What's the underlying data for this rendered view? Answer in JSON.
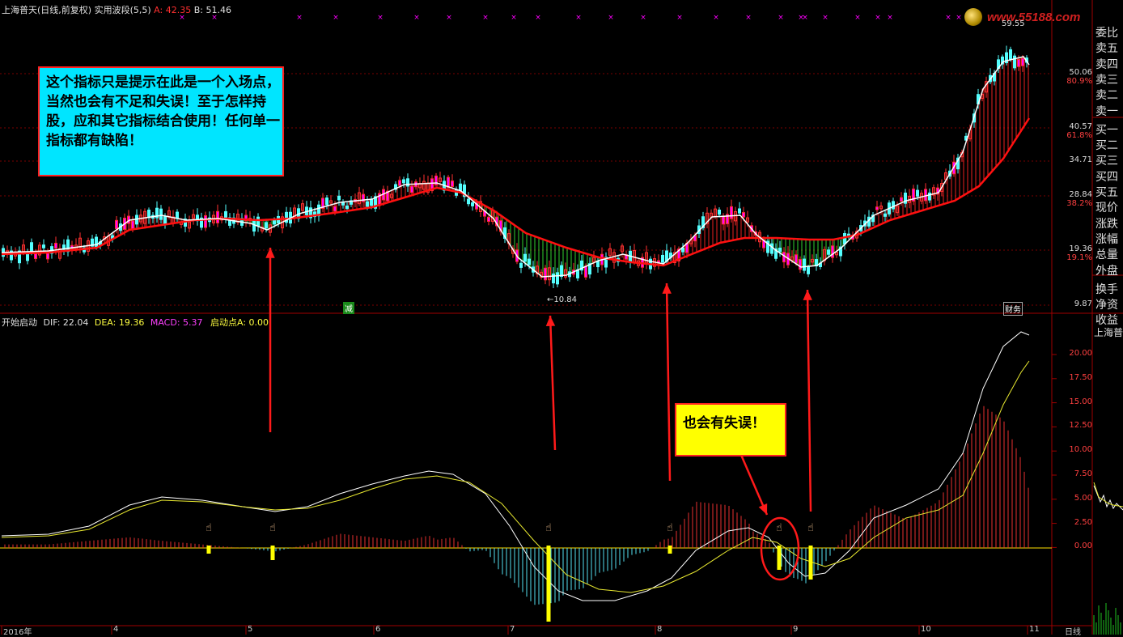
{
  "top_header": {
    "stock_name": "上海普天",
    "mode": "(日线,前复权)",
    "indicator": "实用波段(5,5)",
    "a_label": "A: 42.35",
    "b_label": "B: 51.46",
    "logo_text": "www.55188.com"
  },
  "price_axis": {
    "labels": [
      "50.06",
      "80.9%",
      "40.57",
      "61.8%",
      "34.71",
      "28.84",
      "38.2%",
      "19.36",
      "19.1%",
      "9.87"
    ],
    "peak_label": "59.55",
    "low_label": "←10.84",
    "tag_reduce": "减",
    "tag_fin": "财务"
  },
  "right_panel": {
    "items": [
      "委比",
      "卖五",
      "卖四",
      "卖三",
      "卖二",
      "卖一",
      "买一",
      "买二",
      "买三",
      "买四",
      "买五",
      "现价",
      "涨跌",
      "涨幅",
      "总量",
      "外盘",
      "换手",
      "净资",
      "收益"
    ],
    "lower_title": "上海普"
  },
  "macd_header": {
    "title": "开始启动",
    "dif": "DIF: 22.04",
    "dea": "DEA: 19.36",
    "macd": "MACD: 5.37",
    "start": "启动点A: 0.00"
  },
  "macd_axis": {
    "labels": [
      "20.00",
      "17.50",
      "15.00",
      "12.50",
      "10.00",
      "7.50",
      "5.00",
      "2.50",
      "0.00"
    ]
  },
  "bottom_axis": {
    "labels": [
      "2016年",
      "4",
      "5",
      "6",
      "7",
      "8",
      "9",
      "10",
      "11",
      "日线"
    ]
  },
  "callouts": {
    "main_note": "这个指标只是提示在此是一个入场点，当然也会有不足和失误！至于怎样持股，应和其它指标结合使用！任何单一指标都有缺陷！",
    "fail_note": "也会有失误！"
  },
  "colors": {
    "up": "#ff3030",
    "down": "#54ffff",
    "magenta": "#ff00ff",
    "yellow": "#ffff00",
    "grid": "#7a0000",
    "ma_red": "#ff1010",
    "ma_white": "#ffffff"
  }
}
